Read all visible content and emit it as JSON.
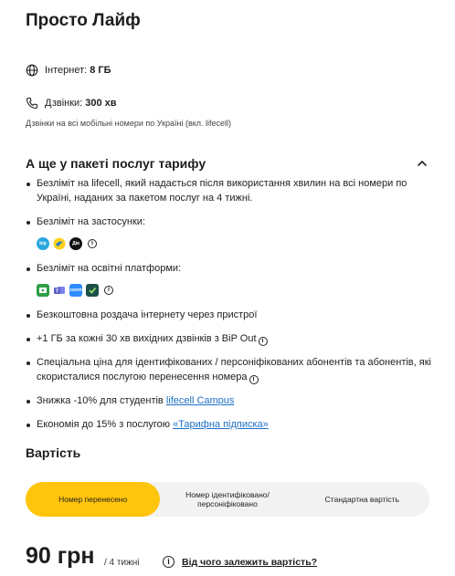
{
  "plan": {
    "title": "Просто Лайф"
  },
  "internet": {
    "label": "Інтернет:",
    "value": "8 ГБ",
    "icon": "globe-icon"
  },
  "calls": {
    "label": "Дзвінки:",
    "value": "300 хв",
    "icon": "phone-icon",
    "note": "Дзвінки на всі мобільні номери по Україні (вкл. lifecell)"
  },
  "extras": {
    "title": "А ще у пакеті послуг тарифу",
    "items": [
      "Безліміт на lifecell, який надається після використання хвилин на всі номери по Україні, наданих за пакетом послуг на 4 тижні.",
      "Безліміт на застосунки:",
      "Безліміт на освітні платформи:",
      "Безкоштовна роздача інтернету через пристрої",
      "+1 ГБ за кожні 30 хв вихідних дзвінків з BiP Out",
      "Спеціальна ціна для ідентифікованих / персоніфікованих абонентів та абонентів, які скористалися послугою перенесення номера",
      "Знижка -10% для студентів ",
      "Економія до 15% з послугою "
    ],
    "campus_link": "lifecell Campus",
    "subscription_link": "«Тарифна підписка»",
    "apps": [
      {
        "icon": "bip-icon",
        "label": "bip",
        "color": "#2aa8e0"
      },
      {
        "icon": "lifecell-bird-icon",
        "label": "",
        "color": "#1f7bd1"
      },
      {
        "icon": "diia-icon",
        "label": "Дія",
        "color": "#111111"
      }
    ],
    "edu": [
      {
        "icon": "google-classroom-icon",
        "label": "",
        "color": "#2f9e44"
      },
      {
        "icon": "ms-teams-icon",
        "label": "",
        "color": "#5b5fc7"
      },
      {
        "icon": "zoom-icon",
        "label": "zoom",
        "color": "#2d8cff"
      },
      {
        "icon": "edu-platform-icon",
        "label": "",
        "color": "#1c4f4a"
      }
    ]
  },
  "cost": {
    "title": "Вартість",
    "options": [
      "Номер перенесено",
      "Номер ідентифіковано/ персоніфіковано",
      "Стандартна вартість"
    ],
    "price": "90 грн",
    "period": "/ 4 тижні",
    "depends": "Від чого залежить вартість?"
  },
  "colors": {
    "accent": "#ffc40c",
    "link": "#1f6fc5"
  }
}
